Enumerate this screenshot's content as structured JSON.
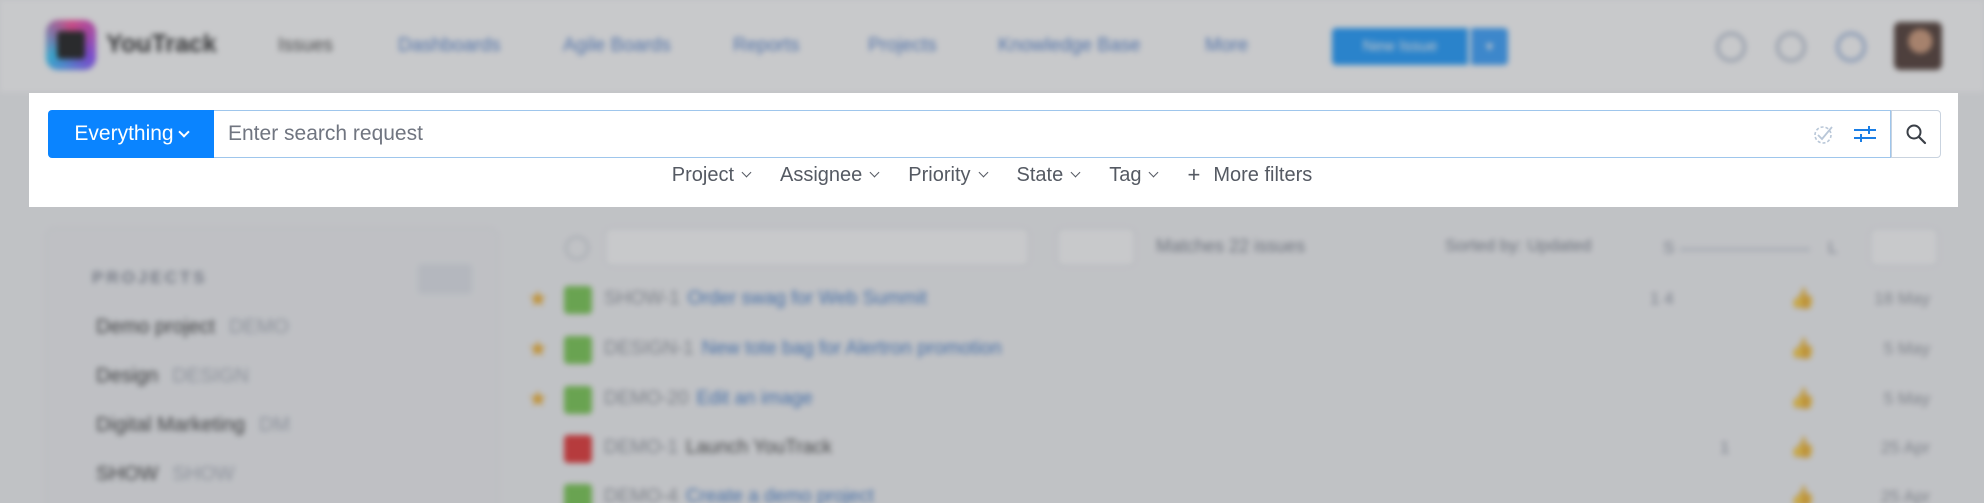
{
  "header": {
    "brand": "YouTrack",
    "nav": [
      "Issues",
      "Dashboards",
      "Agile Boards",
      "Reports",
      "Projects",
      "Knowledge Base",
      "More"
    ],
    "new_issue": "New Issue"
  },
  "sidebar": {
    "heading": "PROJECTS",
    "projects": [
      {
        "name": "Demo project",
        "key": "DEMO"
      },
      {
        "name": "Design",
        "key": "DESIGN"
      },
      {
        "name": "Digital Marketing",
        "key": "DM"
      },
      {
        "name": "SHOW",
        "key": "SHOW"
      }
    ]
  },
  "list_toolbar": {
    "matches": "Matches 22 issues",
    "sorted": "Sorted by: Updated",
    "size_small": "S",
    "size_large": "L"
  },
  "issues": [
    {
      "id": "SHOW-1",
      "title": "Order swag for Web Summit",
      "starred": true,
      "priority": "green",
      "stats": "1   4",
      "date": "18 May"
    },
    {
      "id": "DESIGN-1",
      "title": "New tote bag for Alertron promotion",
      "starred": true,
      "priority": "green",
      "stats": "",
      "date": "5 May"
    },
    {
      "id": "DEMO-20",
      "title": "Edit an image",
      "starred": true,
      "priority": "green",
      "stats": "",
      "date": "5 May"
    },
    {
      "id": "DEMO-1",
      "title": "Launch YouTrack",
      "starred": false,
      "priority": "red",
      "stats": "1",
      "date": "25 Apr"
    },
    {
      "id": "DEMO-4",
      "title": "Create a demo project",
      "starred": false,
      "priority": "green",
      "stats": "",
      "date": "25 Apr"
    }
  ],
  "search": {
    "scope_label": "Everything",
    "placeholder": "Enter search request",
    "value": ""
  },
  "filters": [
    "Project",
    "Assignee",
    "Priority",
    "State",
    "Tag"
  ],
  "more_filters": "More filters",
  "colors": {
    "accent": "#0a84ff",
    "link": "#2f6fc6",
    "star": "#f0a30a"
  },
  "icons": [
    "search-icon",
    "filter-settings-icon",
    "query-check-icon",
    "chevron-down-icon",
    "plus-icon"
  ]
}
